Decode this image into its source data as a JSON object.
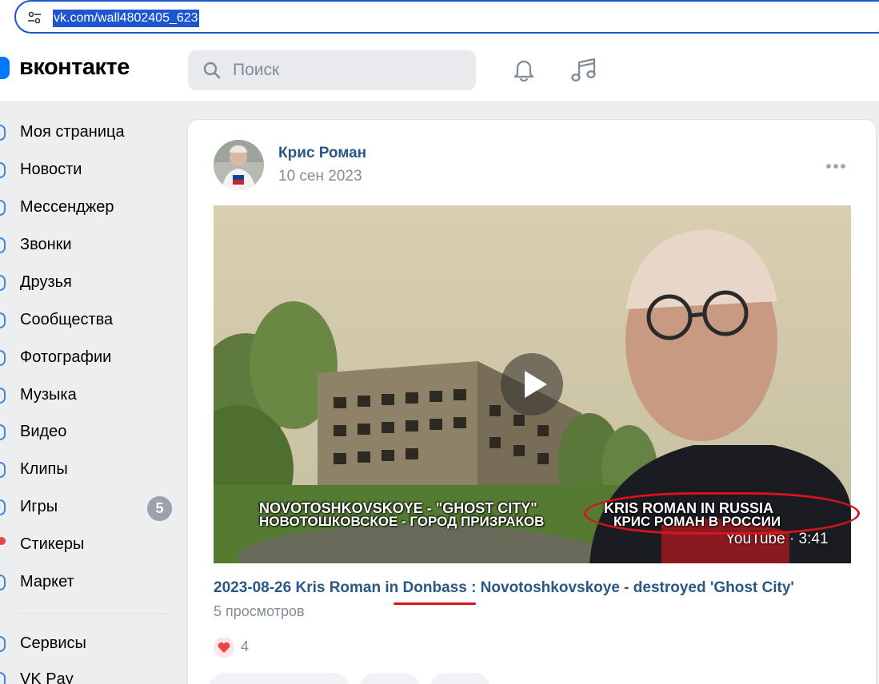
{
  "browser": {
    "url": "vk.com/wall4802405_623"
  },
  "header": {
    "logo_text": "вконтакте",
    "search_placeholder": "Поиск",
    "brand_color": "#0077ff"
  },
  "sidebar": {
    "items": [
      {
        "label": "Моя страница"
      },
      {
        "label": "Новости"
      },
      {
        "label": "Мессенджер"
      },
      {
        "label": "Звонки"
      },
      {
        "label": "Друзья"
      },
      {
        "label": "Сообщества"
      },
      {
        "label": "Фотографии"
      },
      {
        "label": "Музыка"
      },
      {
        "label": "Видео"
      },
      {
        "label": "Клипы"
      },
      {
        "label": "Игры",
        "badge": "5"
      },
      {
        "label": "Стикеры"
      },
      {
        "label": "Маркет"
      }
    ],
    "bottom_items": [
      {
        "label": "Сервисы"
      },
      {
        "label": "VK Pay"
      }
    ]
  },
  "post": {
    "author": "Крис Роман",
    "date": "10 сен 2023",
    "video": {
      "caption_left_line1": "NOVOTOSHKOVSKOYE - \"GHOST CITY\"",
      "caption_left_line2": "НОВОТОШКОВСКОЕ - ГОРОД ПРИЗРАКОВ",
      "caption_right_line1": "KRIS ROMAN IN RUSSIA",
      "caption_right_line2": "КРИС РОМАН В РОССИИ",
      "source_badge": "YouTube · 3:41"
    },
    "title": "2023-08-26 Kris Roman in Donbass : Novotoshkovskoye - destroyed 'Ghost City'",
    "views": "5 просмотров",
    "likes": "4",
    "annotation_color": "#d8141a"
  }
}
